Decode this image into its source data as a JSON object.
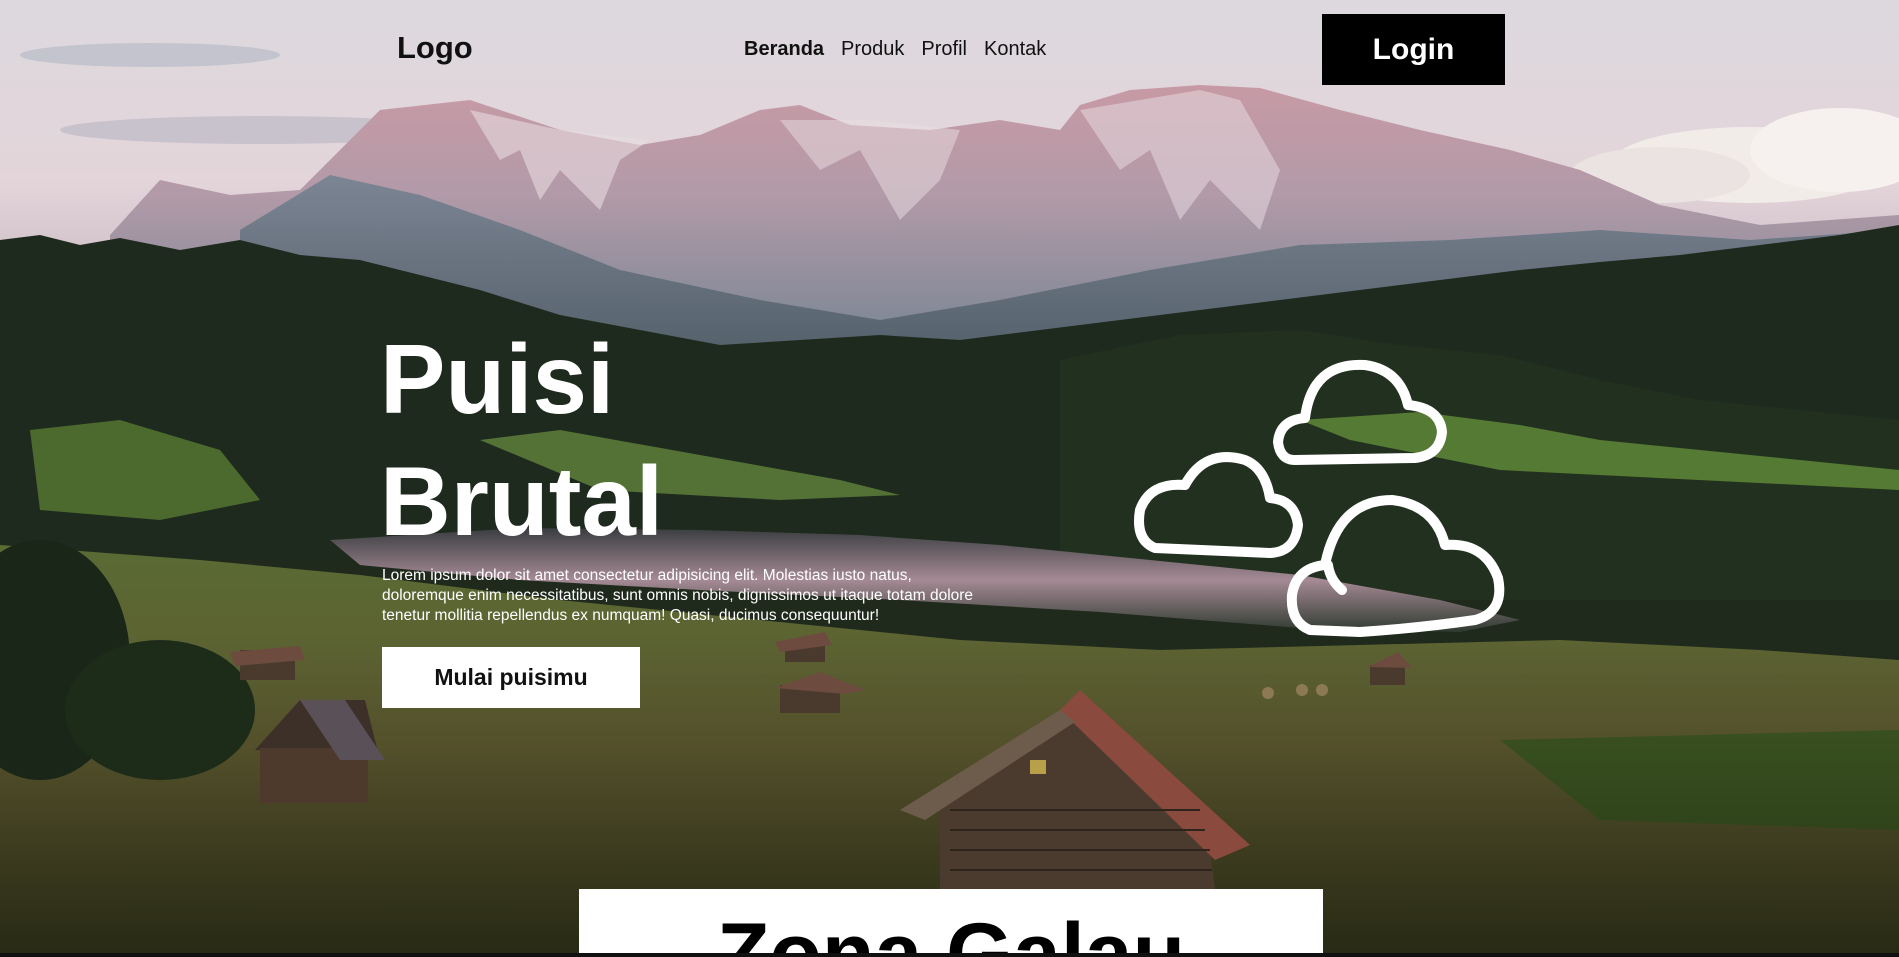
{
  "header": {
    "logo": "Logo",
    "nav": [
      {
        "label": "Beranda",
        "active": true
      },
      {
        "label": "Produk",
        "active": false
      },
      {
        "label": "Profil",
        "active": false
      },
      {
        "label": "Kontak",
        "active": false
      }
    ],
    "login_label": "Login"
  },
  "hero": {
    "title_line1": "Puisi",
    "title_line2": "Brutal",
    "description": "Lorem ipsum dolor sit amet consectetur adipisicing elit. Molestias iusto natus, doloremque enim necessitatibus, sunt omnis nobis, dignissimos ut itaque totam dolore tenetur mollitia repellendus ex numquam! Quasi, ducimus consequuntur!",
    "cta_label": "Mulai puisimu",
    "decoration_icon": "clouds-icon"
  },
  "section": {
    "title": "Zona Galau"
  },
  "colors": {
    "button_dark": "#000000",
    "button_light": "#ffffff",
    "text_dark": "#111111",
    "hero_text": "#ffffff"
  }
}
